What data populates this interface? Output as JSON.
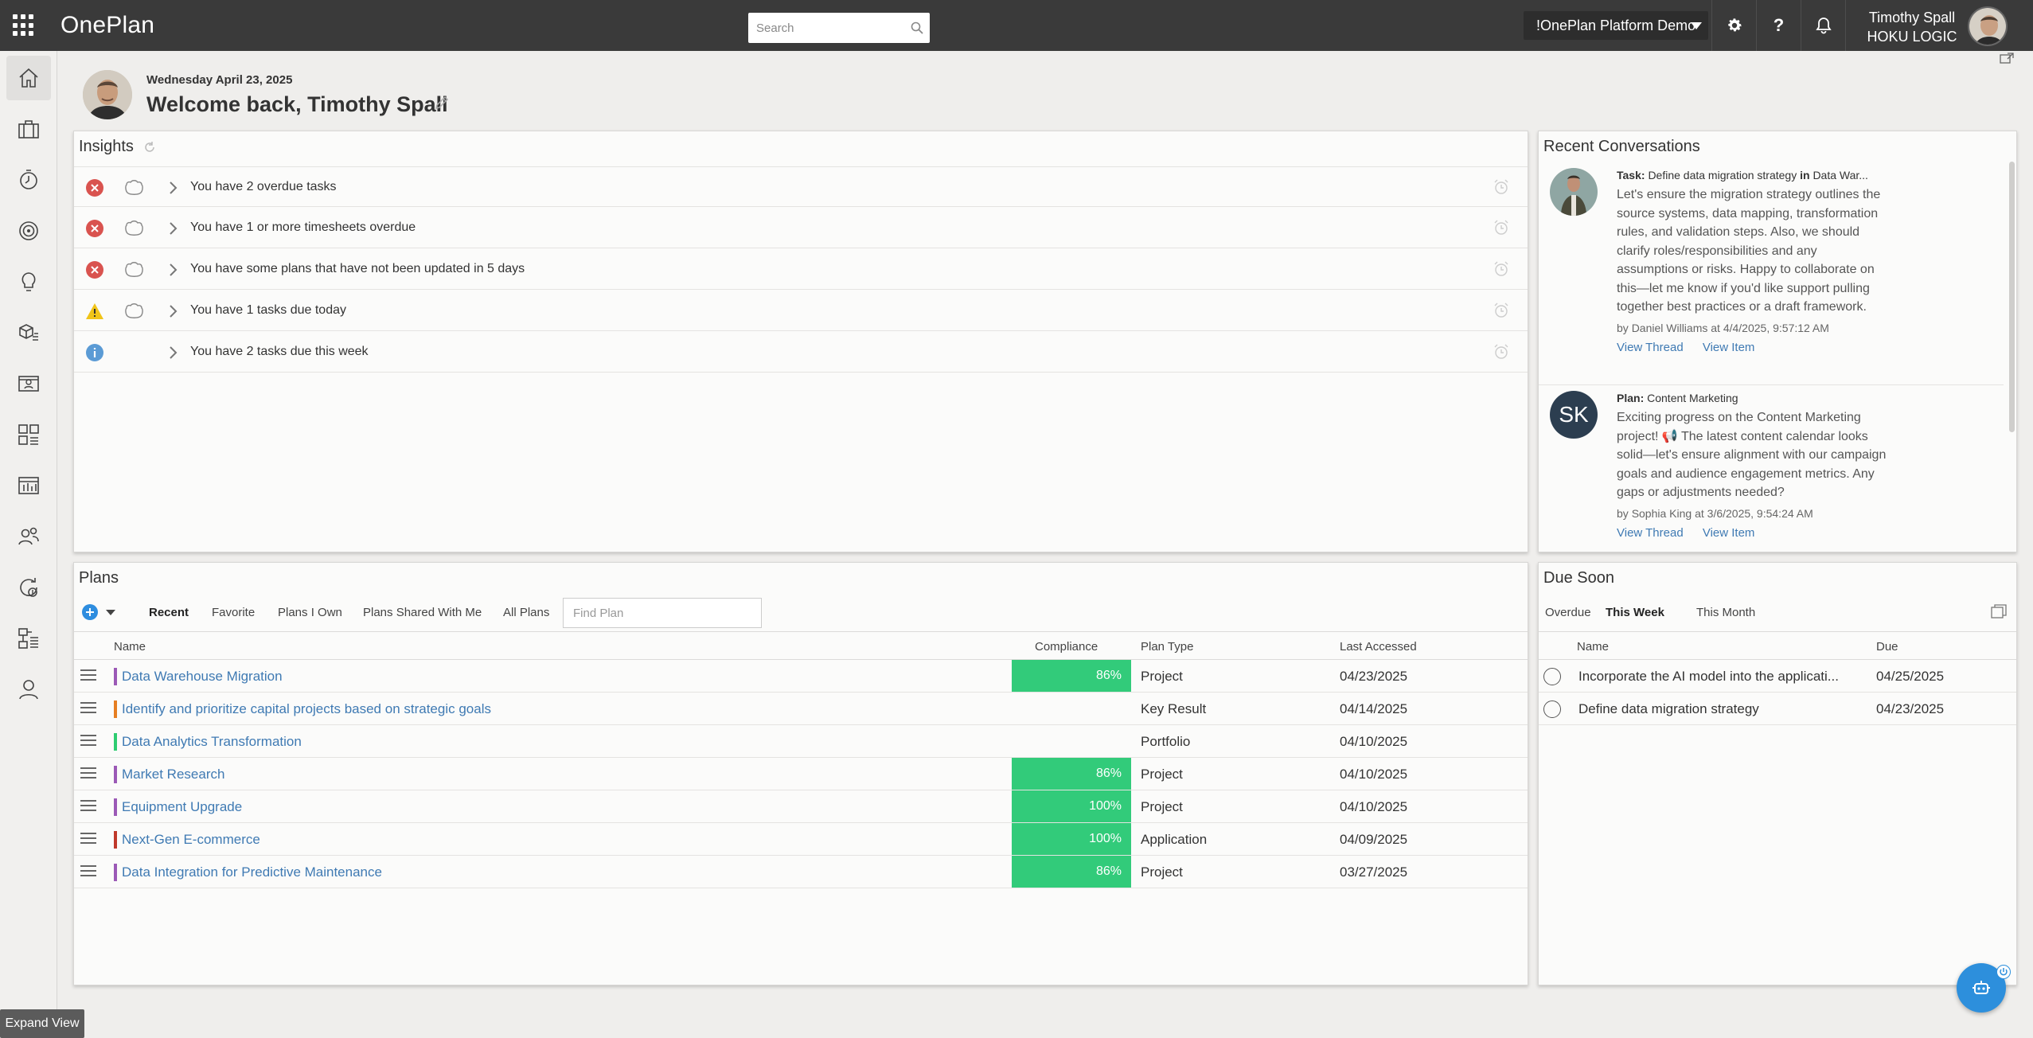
{
  "app": {
    "brand": "OnePlan",
    "search_placeholder": "Search",
    "workspace": "!OnePlan Platform Demo",
    "user_name": "Timothy Spall",
    "user_company": "HOKU LOGIC"
  },
  "sidebar": {
    "items": [
      {
        "icon": "home-icon"
      },
      {
        "icon": "briefcase-icon"
      },
      {
        "icon": "timesheet-icon"
      },
      {
        "icon": "target-icon"
      },
      {
        "icon": "lightbulb-icon"
      },
      {
        "icon": "cube-list-icon"
      },
      {
        "icon": "resource-card-icon"
      },
      {
        "icon": "grid-list-icon"
      },
      {
        "icon": "table-icon"
      },
      {
        "icon": "people-icon"
      },
      {
        "icon": "money-cycle-icon"
      },
      {
        "icon": "hierarchy-icon"
      },
      {
        "icon": "user-icon"
      }
    ],
    "tooltip": "Expand View"
  },
  "header": {
    "date": "Wednesday April 23, 2025",
    "welcome": "Welcome back, Timothy Spall"
  },
  "insights": {
    "title": "Insights",
    "items": [
      {
        "status": "error",
        "text": "You have 2 overdue tasks"
      },
      {
        "status": "error",
        "text": "You have 1 or more timesheets overdue"
      },
      {
        "status": "error",
        "text": "You have some plans that have not been updated in 5 days"
      },
      {
        "status": "warning",
        "text": "You have 1 tasks due today"
      },
      {
        "status": "info",
        "text": "You have 2 tasks due this week"
      }
    ]
  },
  "conversations": {
    "title": "Recent Conversations",
    "items": [
      {
        "type_label": "Task:",
        "subject": "Define data migration strategy",
        "in_label": "in",
        "context": "Data War...",
        "message": "Let's ensure the migration strategy outlines the source systems, data mapping, transformation rules, and validation steps. Also, we should clarify roles/responsibilities and any assumptions or risks. Happy to collaborate on this—let me know if you'd like support pulling together best practices or a draft framework.",
        "by_prefix": "by",
        "author": "Daniel Williams",
        "when": "at 4/4/2025, 9:57:12 AM",
        "view_thread": "View Thread",
        "view_item": "View Item"
      },
      {
        "type_label": "Plan:",
        "subject": "Content Marketing",
        "initials": "SK",
        "message": "Exciting progress on the Content Marketing project! 📢 The latest content calendar looks solid—let's ensure alignment with our campaign goals and audience engagement metrics. Any gaps or adjustments needed?",
        "by_prefix": "by",
        "author": "Sophia King",
        "when": "at 3/6/2025, 9:54:24 AM",
        "view_thread": "View Thread",
        "view_item": "View Item"
      }
    ]
  },
  "plans": {
    "title": "Plans",
    "tabs": [
      "Recent",
      "Favorite",
      "Plans I Own",
      "Plans Shared With Me",
      "All Plans"
    ],
    "find_placeholder": "Find Plan",
    "columns": {
      "name": "Name",
      "compliance": "Compliance",
      "type": "Plan Type",
      "accessed": "Last Accessed"
    },
    "rows": [
      {
        "name": "Data Warehouse Migration",
        "color": "#9b59b6",
        "compliance": "86%",
        "type": "Project",
        "accessed": "04/23/2025"
      },
      {
        "name": "Identify and prioritize capital projects based on strategic goals",
        "color": "#e67e22",
        "compliance": "",
        "type": "Key Result",
        "accessed": "04/14/2025"
      },
      {
        "name": "Data Analytics Transformation",
        "color": "#2ecc71",
        "compliance": "",
        "type": "Portfolio",
        "accessed": "04/10/2025"
      },
      {
        "name": "Market Research",
        "color": "#9b59b6",
        "compliance": "86%",
        "type": "Project",
        "accessed": "04/10/2025"
      },
      {
        "name": "Equipment Upgrade",
        "color": "#9b59b6",
        "compliance": "100%",
        "type": "Project",
        "accessed": "04/10/2025"
      },
      {
        "name": "Next-Gen E-commerce",
        "color": "#c0392b",
        "compliance": "100%",
        "type": "Application",
        "accessed": "04/09/2025"
      },
      {
        "name": "Data Integration for Predictive Maintenance",
        "color": "#9b59b6",
        "compliance": "86%",
        "type": "Project",
        "accessed": "03/27/2025"
      }
    ]
  },
  "due_soon": {
    "title": "Due Soon",
    "tabs": [
      "Overdue",
      "This Week",
      "This Month"
    ],
    "columns": {
      "name": "Name",
      "due": "Due"
    },
    "rows": [
      {
        "name": "Incorporate the AI model into the applicati...",
        "due": "04/25/2025"
      },
      {
        "name": "Define data migration strategy",
        "due": "04/23/2025"
      }
    ]
  },
  "colors": {
    "topbar": "#3a3a3a",
    "compliance_green": "#32cb7a",
    "link_blue": "#3f7ab3",
    "error_red": "#d9534f",
    "warning_yellow": "#f0c419",
    "info_blue": "#5b9bd5"
  }
}
